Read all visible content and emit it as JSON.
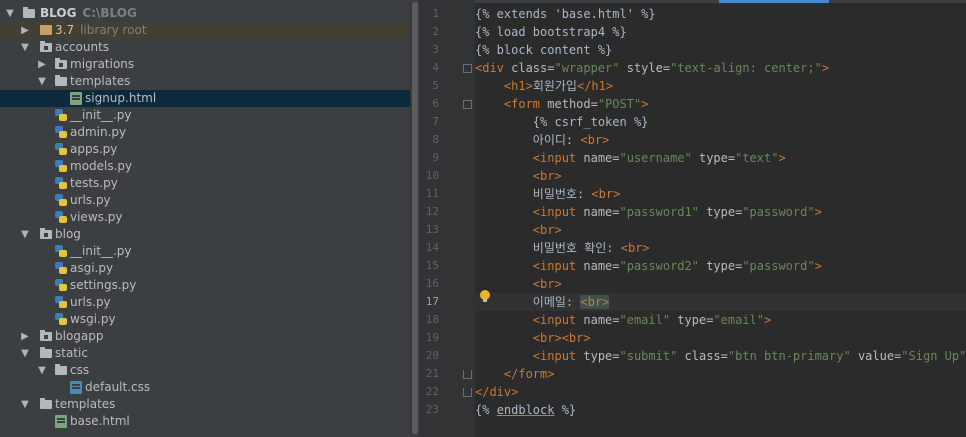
{
  "project_tree": {
    "root": {
      "name": "BLOG",
      "path": "C:\\BLOG"
    },
    "items": [
      {
        "label": "3.7",
        "hint": "library root",
        "kind": "library",
        "expanded": false
      },
      {
        "label": "accounts",
        "kind": "package",
        "expanded": true
      },
      {
        "label": "migrations",
        "kind": "package",
        "expanded": false
      },
      {
        "label": "templates",
        "kind": "folder",
        "expanded": true
      },
      {
        "label": "signup.html",
        "kind": "html"
      },
      {
        "label": "__init__.py",
        "kind": "python"
      },
      {
        "label": "admin.py",
        "kind": "python"
      },
      {
        "label": "apps.py",
        "kind": "python"
      },
      {
        "label": "models.py",
        "kind": "python"
      },
      {
        "label": "tests.py",
        "kind": "python"
      },
      {
        "label": "urls.py",
        "kind": "python"
      },
      {
        "label": "views.py",
        "kind": "python"
      },
      {
        "label": "blog",
        "kind": "package",
        "expanded": true
      },
      {
        "label": "__init__.py",
        "kind": "python"
      },
      {
        "label": "asgi.py",
        "kind": "python"
      },
      {
        "label": "settings.py",
        "kind": "python"
      },
      {
        "label": "urls.py",
        "kind": "python"
      },
      {
        "label": "wsgi.py",
        "kind": "python"
      },
      {
        "label": "blogapp",
        "kind": "package",
        "expanded": false
      },
      {
        "label": "static",
        "kind": "folder",
        "expanded": true
      },
      {
        "label": "css",
        "kind": "folder",
        "expanded": true
      },
      {
        "label": "default.css",
        "kind": "css"
      },
      {
        "label": "templates",
        "kind": "folder",
        "expanded": true
      },
      {
        "label": "base.html",
        "kind": "html"
      }
    ]
  },
  "editor": {
    "current_line": 17,
    "lines": [
      {
        "n": "1",
        "tokens": [
          [
            "tpl",
            "{% extends 'base.html' %}"
          ]
        ]
      },
      {
        "n": "2",
        "tokens": [
          [
            "tpl",
            "{% load bootstrap4 %}"
          ]
        ]
      },
      {
        "n": "3",
        "tokens": [
          [
            "tpl",
            "{% block content %}"
          ]
        ]
      },
      {
        "n": "4",
        "tokens": [
          [
            "kw",
            "<div "
          ],
          [
            "attr",
            "class="
          ],
          [
            "str",
            "\"wrapper\" "
          ],
          [
            "attr",
            "style="
          ],
          [
            "str",
            "\"text-align: center;\""
          ],
          [
            "kw",
            ">"
          ]
        ]
      },
      {
        "n": "5",
        "tokens": [
          [
            "plain",
            "    "
          ],
          [
            "kw",
            "<h1>"
          ],
          [
            "plain",
            "회원가입"
          ],
          [
            "kw",
            "</h1>"
          ]
        ]
      },
      {
        "n": "6",
        "tokens": [
          [
            "plain",
            "    "
          ],
          [
            "kw",
            "<form "
          ],
          [
            "attr",
            "method="
          ],
          [
            "str",
            "\"POST\""
          ],
          [
            "kw",
            ">"
          ]
        ]
      },
      {
        "n": "7",
        "tokens": [
          [
            "plain",
            "        "
          ],
          [
            "tpl",
            "{% csrf_token %}"
          ]
        ]
      },
      {
        "n": "8",
        "tokens": [
          [
            "plain",
            "        아이디: "
          ],
          [
            "kw",
            "<br>"
          ]
        ]
      },
      {
        "n": "9",
        "tokens": [
          [
            "plain",
            "        "
          ],
          [
            "kw",
            "<input "
          ],
          [
            "attr",
            "name="
          ],
          [
            "str",
            "\"username\" "
          ],
          [
            "attr",
            "type="
          ],
          [
            "str",
            "\"text\""
          ],
          [
            "kw",
            ">"
          ]
        ]
      },
      {
        "n": "10",
        "tokens": [
          [
            "plain",
            "        "
          ],
          [
            "kw",
            "<br>"
          ]
        ]
      },
      {
        "n": "11",
        "tokens": [
          [
            "plain",
            "        비밀번호: "
          ],
          [
            "kw",
            "<br>"
          ]
        ]
      },
      {
        "n": "12",
        "tokens": [
          [
            "plain",
            "        "
          ],
          [
            "kw",
            "<input "
          ],
          [
            "attr",
            "name="
          ],
          [
            "str",
            "\"password1\" "
          ],
          [
            "attr",
            "type="
          ],
          [
            "str",
            "\"password\""
          ],
          [
            "kw",
            ">"
          ]
        ]
      },
      {
        "n": "13",
        "tokens": [
          [
            "plain",
            "        "
          ],
          [
            "kw",
            "<br>"
          ]
        ]
      },
      {
        "n": "14",
        "tokens": [
          [
            "plain",
            "        비밀번호 확인: "
          ],
          [
            "kw",
            "<br>"
          ]
        ]
      },
      {
        "n": "15",
        "tokens": [
          [
            "plain",
            "        "
          ],
          [
            "kw",
            "<input "
          ],
          [
            "attr",
            "name="
          ],
          [
            "str",
            "\"password2\" "
          ],
          [
            "attr",
            "type="
          ],
          [
            "str",
            "\"password\""
          ],
          [
            "kw",
            ">"
          ]
        ]
      },
      {
        "n": "16",
        "tokens": [
          [
            "plain",
            "        "
          ],
          [
            "kw",
            "<br>"
          ]
        ]
      },
      {
        "n": "17",
        "tokens": [
          [
            "plain",
            "        이메일: "
          ],
          [
            "hl",
            "<br>"
          ]
        ]
      },
      {
        "n": "18",
        "tokens": [
          [
            "plain",
            "        "
          ],
          [
            "kw",
            "<input "
          ],
          [
            "attr",
            "name="
          ],
          [
            "str",
            "\"email\" "
          ],
          [
            "attr",
            "type="
          ],
          [
            "str",
            "\"email\""
          ],
          [
            "kw",
            ">"
          ]
        ]
      },
      {
        "n": "19",
        "tokens": [
          [
            "plain",
            "        "
          ],
          [
            "kw",
            "<br><br>"
          ]
        ]
      },
      {
        "n": "20",
        "tokens": [
          [
            "plain",
            "        "
          ],
          [
            "kw",
            "<input "
          ],
          [
            "attr",
            "type="
          ],
          [
            "str",
            "\"submit\" "
          ],
          [
            "attr",
            "class="
          ],
          [
            "str",
            "\"btn btn-primary\" "
          ],
          [
            "attr",
            "value="
          ],
          [
            "str",
            "\"Sign Up\""
          ],
          [
            "kw",
            ">"
          ]
        ]
      },
      {
        "n": "21",
        "tokens": [
          [
            "plain",
            "    "
          ],
          [
            "kw",
            "</form>"
          ]
        ]
      },
      {
        "n": "22",
        "tokens": [
          [
            "kw",
            "</div>"
          ]
        ]
      },
      {
        "n": "23",
        "tokens": [
          [
            "tpl",
            "{% "
          ],
          [
            "under",
            "endblock"
          ],
          [
            "tpl",
            " %}"
          ]
        ]
      }
    ]
  },
  "colors": {
    "panel_bg": "#3c3f41",
    "editor_bg": "#2b2b2b",
    "selection": "#0d293e",
    "keyword": "#cc7832",
    "string": "#6a8759",
    "attribute": "#bababa",
    "text": "#a9b7c6"
  }
}
